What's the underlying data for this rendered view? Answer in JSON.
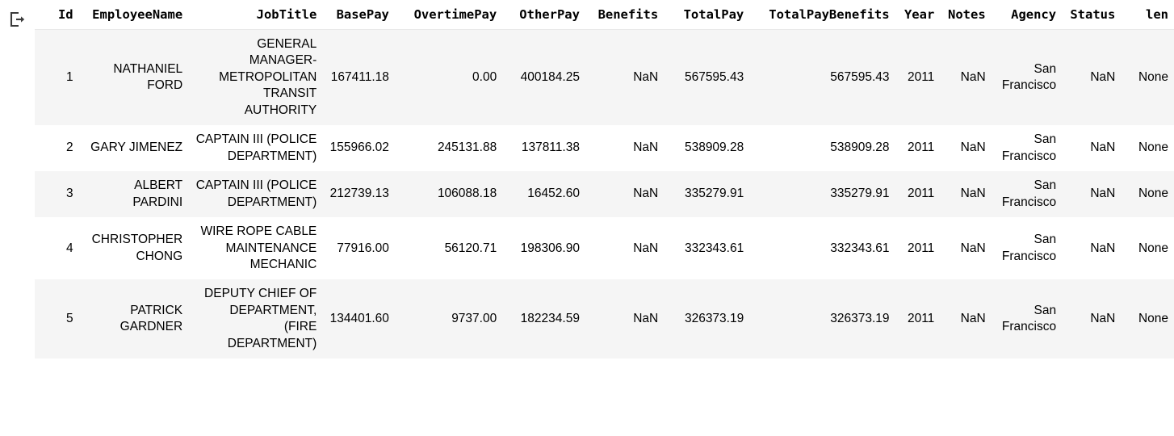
{
  "output_prompt": {
    "icon": "output-arrow-icon"
  },
  "table": {
    "columns": [
      "Id",
      "EmployeeName",
      "JobTitle",
      "BasePay",
      "OvertimePay",
      "OtherPay",
      "Benefits",
      "TotalPay",
      "TotalPayBenefits",
      "Year",
      "Notes",
      "Agency",
      "Status",
      "len"
    ],
    "rows": [
      {
        "Id": "1",
        "EmployeeName": "NATHANIEL FORD",
        "JobTitle": "GENERAL MANAGER-METROPOLITAN TRANSIT AUTHORITY",
        "BasePay": "167411.18",
        "OvertimePay": "0.00",
        "OtherPay": "400184.25",
        "Benefits": "NaN",
        "TotalPay": "567595.43",
        "TotalPayBenefits": "567595.43",
        "Year": "2011",
        "Notes": "NaN",
        "Agency": "San Francisco",
        "Status": "NaN",
        "len": "None"
      },
      {
        "Id": "2",
        "EmployeeName": "GARY JIMENEZ",
        "JobTitle": "CAPTAIN III (POLICE DEPARTMENT)",
        "BasePay": "155966.02",
        "OvertimePay": "245131.88",
        "OtherPay": "137811.38",
        "Benefits": "NaN",
        "TotalPay": "538909.28",
        "TotalPayBenefits": "538909.28",
        "Year": "2011",
        "Notes": "NaN",
        "Agency": "San Francisco",
        "Status": "NaN",
        "len": "None"
      },
      {
        "Id": "3",
        "EmployeeName": "ALBERT PARDINI",
        "JobTitle": "CAPTAIN III (POLICE DEPARTMENT)",
        "BasePay": "212739.13",
        "OvertimePay": "106088.18",
        "OtherPay": "16452.60",
        "Benefits": "NaN",
        "TotalPay": "335279.91",
        "TotalPayBenefits": "335279.91",
        "Year": "2011",
        "Notes": "NaN",
        "Agency": "San Francisco",
        "Status": "NaN",
        "len": "None"
      },
      {
        "Id": "4",
        "EmployeeName": "CHRISTOPHER CHONG",
        "JobTitle": "WIRE ROPE CABLE MAINTENANCE MECHANIC",
        "BasePay": "77916.00",
        "OvertimePay": "56120.71",
        "OtherPay": "198306.90",
        "Benefits": "NaN",
        "TotalPay": "332343.61",
        "TotalPayBenefits": "332343.61",
        "Year": "2011",
        "Notes": "NaN",
        "Agency": "San Francisco",
        "Status": "NaN",
        "len": "None"
      },
      {
        "Id": "5",
        "EmployeeName": "PATRICK GARDNER",
        "JobTitle": "DEPUTY CHIEF OF DEPARTMENT, (FIRE DEPARTMENT)",
        "BasePay": "134401.60",
        "OvertimePay": "9737.00",
        "OtherPay": "182234.59",
        "Benefits": "NaN",
        "TotalPay": "326373.19",
        "TotalPayBenefits": "326373.19",
        "Year": "2011",
        "Notes": "NaN",
        "Agency": "San Francisco",
        "Status": "NaN",
        "len": "None"
      }
    ]
  }
}
